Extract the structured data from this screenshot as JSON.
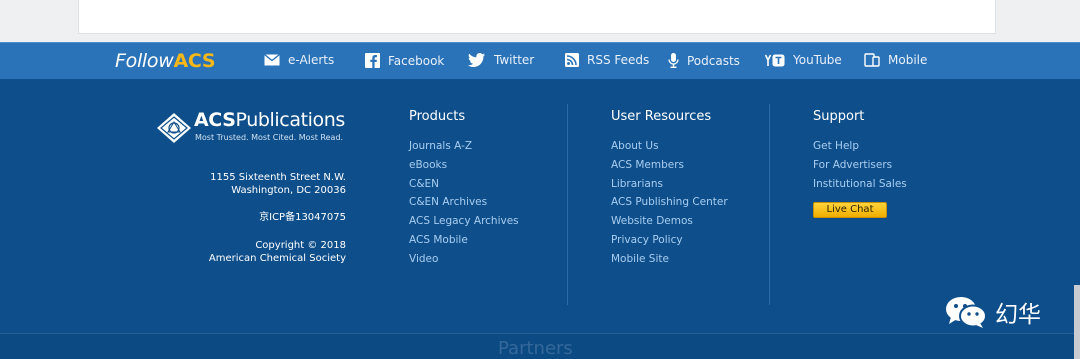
{
  "follow": {
    "prefix": "Follow",
    "brand": "ACS",
    "links": [
      {
        "label": "e-Alerts",
        "icon": "envelope-icon"
      },
      {
        "label": "Facebook",
        "icon": "facebook-icon"
      },
      {
        "label": "Twitter",
        "icon": "twitter-bird-icon"
      },
      {
        "label": "RSS Feeds",
        "icon": "rss-icon"
      },
      {
        "label": "Podcasts",
        "icon": "microphone-icon"
      },
      {
        "label": "YouTube",
        "icon": "youtube-icon"
      },
      {
        "label": "Mobile",
        "icon": "mobile-devices-icon"
      }
    ]
  },
  "logo": {
    "name_bold": "ACS",
    "name_rest": "Publications",
    "tagline": "Most Trusted. Most Cited. Most Read."
  },
  "address": {
    "line1": "1155 Sixteenth Street N.W.",
    "line2": "Washington, DC 20036",
    "icp": "京ICP备13047075",
    "copyright": "Copyright © 2018",
    "org": "American Chemical Society"
  },
  "products": {
    "title": "Products",
    "links": [
      "Journals A-Z",
      "eBooks",
      "C&EN",
      "C&EN Archives",
      "ACS Legacy Archives",
      "ACS Mobile",
      "Video"
    ]
  },
  "user_resources": {
    "title": "User Resources",
    "links": [
      "About Us",
      "ACS Members",
      "Librarians",
      "ACS Publishing Center",
      "Website Demos",
      "Privacy Policy",
      "Mobile Site"
    ]
  },
  "support": {
    "title": "Support",
    "links": [
      "Get Help",
      "For Advertisers",
      "Institutional Sales"
    ],
    "live_chat": "Live Chat"
  },
  "partners": "Partners",
  "watermark": "幻华",
  "colors": {
    "follow_bar": "#2a73b8",
    "footer": "#0e4f8b",
    "brand_accent": "#f5b818",
    "link": "#a9cdf0",
    "live_chat": "#f5c400"
  }
}
